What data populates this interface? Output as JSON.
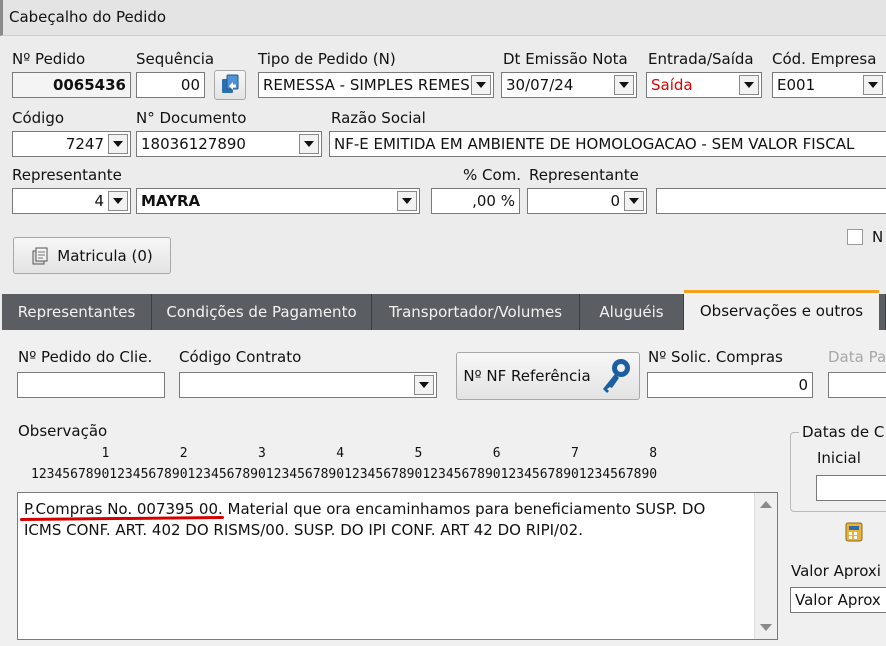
{
  "header": {
    "title": "Cabeçalho do Pedido"
  },
  "row1": {
    "pedido_label": "Nº Pedido",
    "pedido_value": "0065436",
    "sequencia_label": "Sequência",
    "sequencia_value": "00",
    "tipo_label": "Tipo de Pedido (N)",
    "tipo_value": "REMESSA - SIMPLES REMES",
    "emissao_label": "Dt Emissão Nota",
    "emissao_value": "30/07/24",
    "es_label": "Entrada/Saída",
    "es_value": "Saída",
    "empresa_label": "Cód. Empresa",
    "empresa_value": "E001"
  },
  "row2": {
    "codigo_label": "Código",
    "codigo_value": "7247",
    "documento_label": "N° Documento",
    "documento_value": "18036127890",
    "razao_label": "Razão Social",
    "razao_value": "NF-E EMITIDA EM AMBIENTE DE HOMOLOGACAO - SEM VALOR FISCAL"
  },
  "row3": {
    "rep_label": "Representante",
    "rep_code": "4",
    "rep_name": "MAYRA",
    "com_label": "% Com.",
    "com_value": ",00 %",
    "rep2_label": "Representante",
    "rep2_code": "0",
    "rep2_name": ""
  },
  "matricula_button": "Matricula (0)",
  "checkbox_label": "N",
  "tabs": [
    {
      "label": "Representantes"
    },
    {
      "label": "Condições de Pagamento"
    },
    {
      "label": "Transportador/Volumes"
    },
    {
      "label": "Aluguéis"
    },
    {
      "label": "Observações e outros"
    }
  ],
  "obs_tab": {
    "pedido_cliente_label": "Nº Pedido do Clie.",
    "pedido_cliente_value": "",
    "contrato_label": "Código Contrato",
    "contrato_value": "",
    "nf_ref_button": "Nº NF Referência",
    "solic_label": "Nº Solic. Compras",
    "solic_value": "0",
    "data_label": "Data Pa",
    "observacao_label": "Observação",
    "ruler_tens": "         1         2         3         4         5         6         7         8",
    "ruler_units": "12345678901234567890123456789012345678901234567890123456789012345678901234567890",
    "observacao_line1": "P.Compras No. 007395 00. Material que ora encaminhamos para beneficiamento SUSP. DO",
    "observacao_line2": "ICMS CONF. ART. 402 DO RISMS/00. SUSP. DO IPI CONF. ART 42 DO RIPI/02.",
    "datas_group_label": "Datas de C",
    "inicial_label": "Inicial",
    "valor_label": "Valor Aproxi",
    "valor_value": "Valor Aprox"
  },
  "colors": {
    "accent_tab": "#f2a31b",
    "tab_dark": "#5a5d62",
    "saida_red": "#e00000",
    "annotation_red": "#d40000"
  }
}
